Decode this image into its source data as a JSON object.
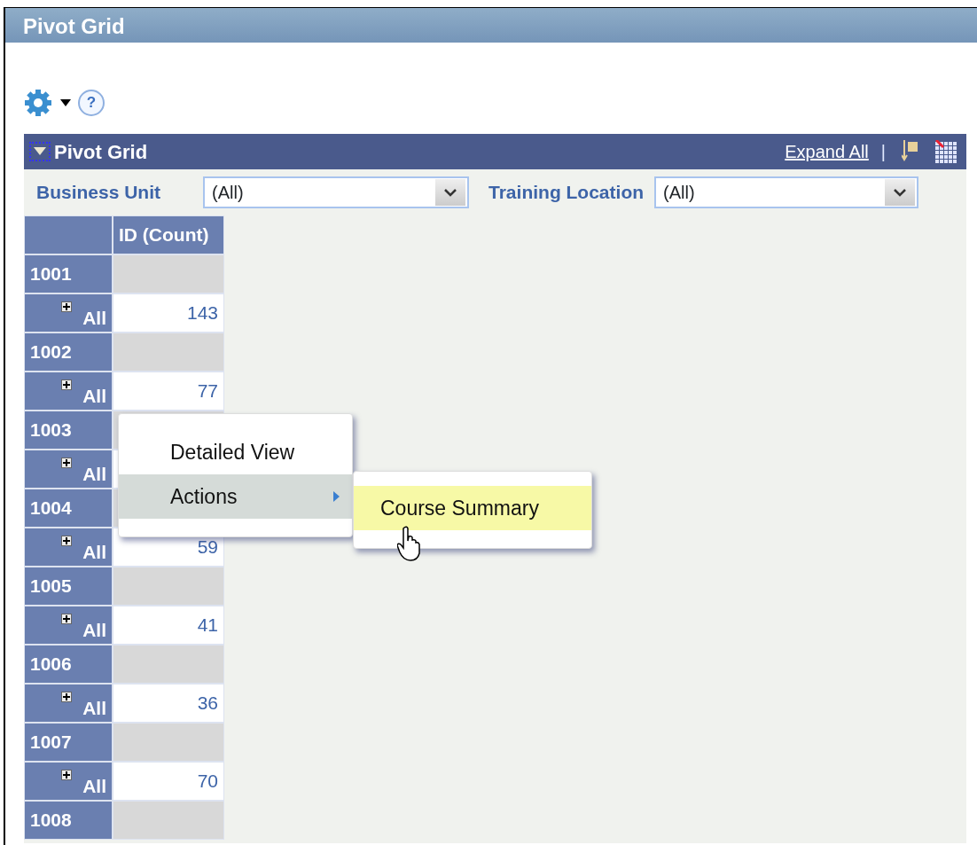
{
  "window": {
    "title": "Pivot Grid"
  },
  "toolbar": {
    "help": "?"
  },
  "panel": {
    "title": "Pivot Grid",
    "expanded": true,
    "expand_all": "Expand All",
    "separator": "|"
  },
  "filters": [
    {
      "label": "Business Unit",
      "value": "(All)"
    },
    {
      "label": "Training Location",
      "value": "(All)"
    }
  ],
  "grid": {
    "columns": [
      "ID (Count)"
    ],
    "groups": [
      {
        "label": "1001",
        "children": [
          {
            "label": "All",
            "value": "143"
          }
        ]
      },
      {
        "label": "1002",
        "children": [
          {
            "label": "All",
            "value": "77"
          }
        ]
      },
      {
        "label": "1003",
        "children": [
          {
            "label": "All"
          }
        ]
      },
      {
        "label": "1004",
        "children": [
          {
            "label": "All",
            "value": "59"
          }
        ]
      },
      {
        "label": "1005",
        "children": [
          {
            "label": "All",
            "value": "41"
          }
        ]
      },
      {
        "label": "1006",
        "children": [
          {
            "label": "All",
            "value": "36"
          }
        ]
      },
      {
        "label": "1007",
        "children": [
          {
            "label": "All",
            "value": "70"
          }
        ]
      },
      {
        "label": "1008"
      }
    ]
  },
  "context_menu": {
    "items": [
      {
        "label": "Detailed View",
        "selected": false,
        "submenu": false
      },
      {
        "label": "Actions",
        "selected": true,
        "submenu": true
      }
    ],
    "submenu": {
      "items": [
        {
          "label": "Course Summary",
          "selected": true
        }
      ]
    }
  }
}
